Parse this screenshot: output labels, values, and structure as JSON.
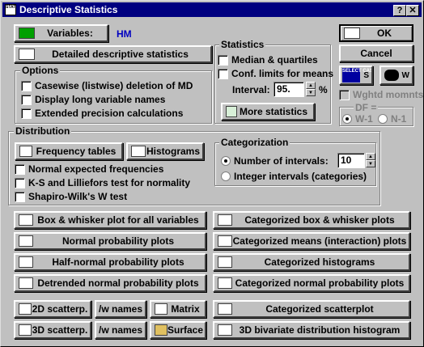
{
  "window": {
    "title": "Descriptive Statistics",
    "icon_text": "STAT"
  },
  "titlebar": {
    "help": "?",
    "close": "✕"
  },
  "variables": {
    "button_label": "Variables:",
    "value": "HM"
  },
  "detailed_button": "Detailed descriptive statistics",
  "options": {
    "title": "Options",
    "items": [
      {
        "label": "Casewise (listwise) deletion of MD",
        "checked": false
      },
      {
        "label": "Display long variable names",
        "checked": false
      },
      {
        "label": "Extended precision calculations",
        "checked": false
      }
    ]
  },
  "statistics": {
    "title": "Statistics",
    "median": "Median & quartiles",
    "conf": "Conf. limits for means",
    "interval_label": "Interval:",
    "interval_value": "95.",
    "interval_unit": "%",
    "more_button": "More statistics"
  },
  "right": {
    "ok": "OK",
    "cancel": "Cancel",
    "select_cases": "SELECT CASES",
    "s": "S",
    "w": "W",
    "wghtd": "Wghtd momnts",
    "df_title": "DF =",
    "df_options": [
      "W-1",
      "N-1"
    ]
  },
  "distribution": {
    "title": "Distribution",
    "freq_button": "Frequency tables",
    "hist_button": "Histograms",
    "items": [
      "Normal expected frequencies",
      "K-S and Lilliefors test for normality",
      "Shapiro-Wilk's W test"
    ]
  },
  "categorization": {
    "title": "Categorization",
    "num_intervals": "Number of intervals:",
    "intervals_value": "10",
    "integer_intervals": "Integer intervals (categories)"
  },
  "buttons_left": [
    "Box & whisker plot for all variables",
    "Normal probability plots",
    "Half-normal probability plots",
    "Detrended normal probability plots"
  ],
  "buttons_right": [
    "Categorized box & whisker plots",
    "Categorized means (interaction) plots",
    "Categorized histograms",
    "Categorized normal probability plots",
    "Categorized scatterplot",
    "3D bivariate distribution histogram"
  ],
  "bottom": {
    "scatter2d": "2D scatterp.",
    "scatter3d": "3D scatterp.",
    "wnames": "/w names",
    "matrix": "Matrix",
    "surface": "Surface"
  },
  "colors": {
    "title_bg": "#000080",
    "variable_value": "#0000c0",
    "face": "#c0c0c0"
  }
}
